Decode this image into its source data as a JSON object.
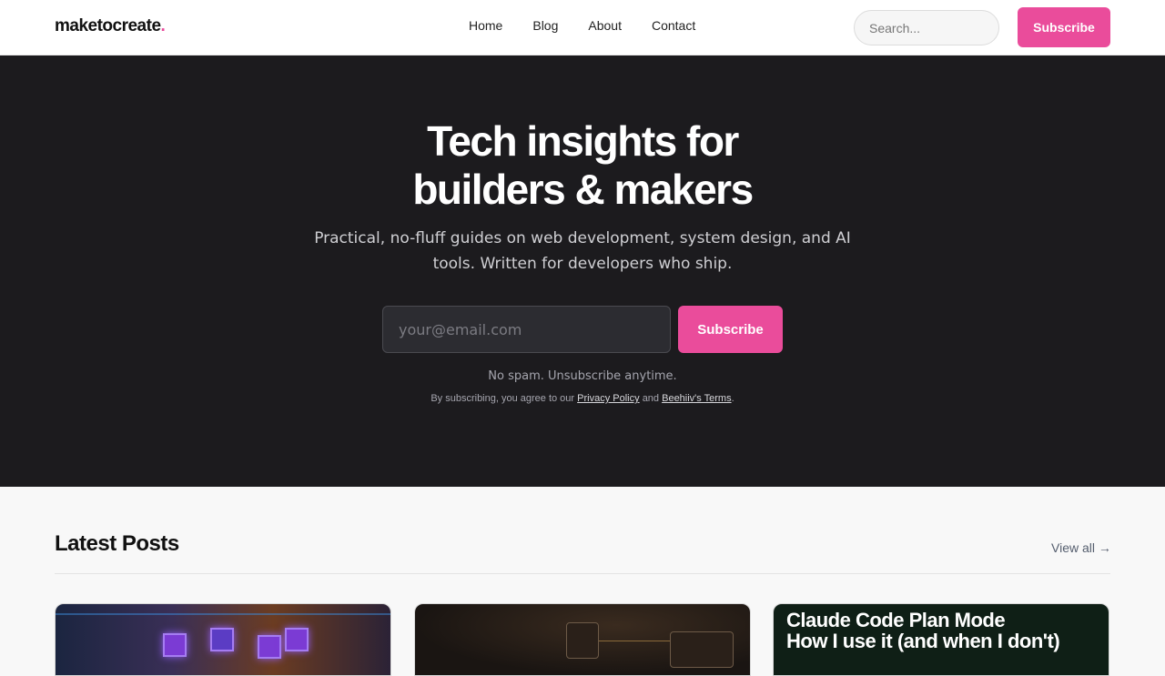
{
  "header": {
    "logo_text": "maketocreate",
    "logo_dot": ".",
    "nav": [
      "Home",
      "Blog",
      "About",
      "Contact"
    ],
    "search_placeholder": "Search...",
    "subscribe_label": "Subscribe"
  },
  "hero": {
    "title_line1": "Tech insights for",
    "title_line2": "builders & makers",
    "subtitle": "Practical, no-fluff guides on web development, system design, and AI tools. Written for developers who ship.",
    "email_placeholder": "your@email.com",
    "subscribe_label": "Subscribe",
    "no_spam": "No spam. Unsubscribe anytime.",
    "legal_prefix": "By subscribing, you agree to our",
    "privacy_link": "Privacy Policy",
    "legal_and": "and",
    "terms_link": "Beehiiv's Terms",
    "legal_suffix": "."
  },
  "posts": {
    "title": "Latest Posts",
    "view_all": "View all →",
    "card3_line1": "Claude Code Plan Mode",
    "card3_line2": "How I use it (and when I don't)"
  },
  "colors": {
    "accent": "#ea4c9b",
    "hero_bg": "#1c1b1e"
  }
}
